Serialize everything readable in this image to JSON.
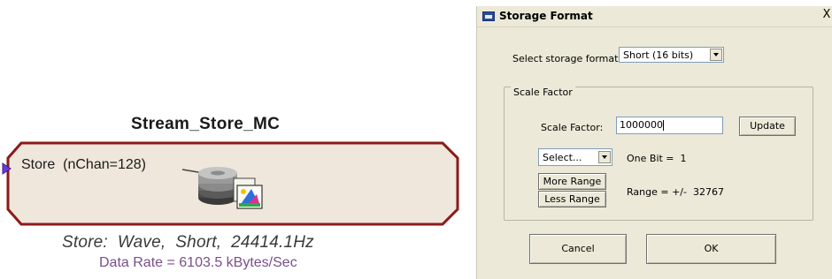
{
  "block": {
    "title": "Stream_Store_MC",
    "port_label": "Store  (nChan=128)",
    "icon": "storage-disk-icon",
    "store_info": "Store:  Wave,  Short,  24414.1Hz",
    "data_rate": "Data Rate = 6103.5 kBytes/Sec",
    "colors": {
      "border": "#8b1a1a",
      "fill": "#efe7dc",
      "port": "#6a3bd9",
      "data_rate_text": "#7a4f8a"
    }
  },
  "dialog": {
    "title": "Storage Format",
    "close_glyph": "X",
    "format_label": "Select storage format:",
    "format_value": "Short (16 bits)",
    "group_label": "Scale Factor",
    "scale_label": "Scale Factor:",
    "scale_value": "1000000",
    "update_button": "Update",
    "select_value": "Select...",
    "one_bit": "One Bit =  1",
    "more_range_button": "More Range",
    "less_range_button": "Less Range",
    "range_text": "Range = +/-  32767",
    "cancel_button": "Cancel",
    "ok_button": "OK",
    "colors": {
      "background": "#ece9d8",
      "title_icon": "#2b4c9b"
    }
  }
}
